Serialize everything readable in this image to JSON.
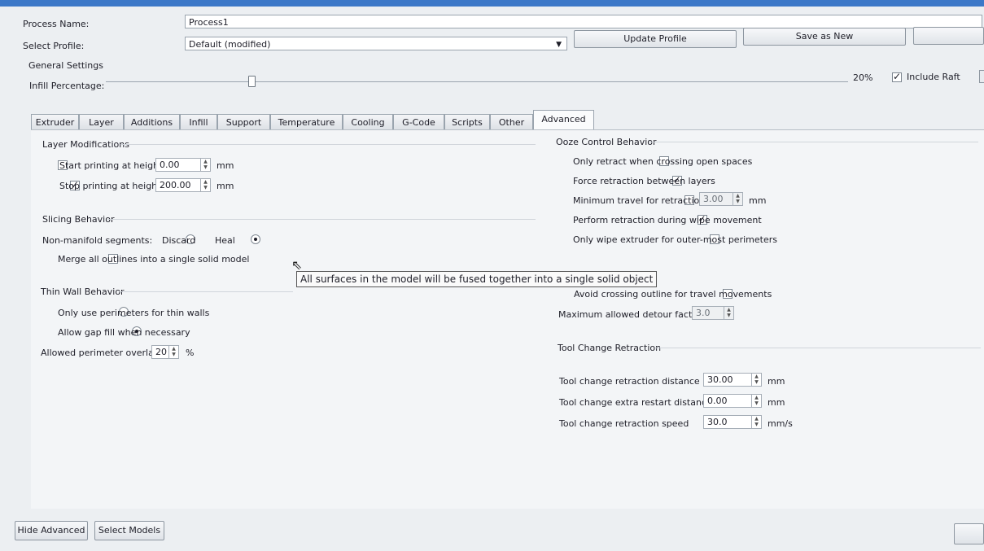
{
  "general": {
    "process_name_label": "Process Name:",
    "process_name_value": "Process1",
    "select_profile_label": "Select Profile:",
    "profile_value": "Default (modified)",
    "update_profile": "Update Profile",
    "save_as_new": "Save as New",
    "general_settings": "General Settings",
    "infill_label": "Infill Percentage:",
    "infill_percent_text": "20%",
    "infill_fraction": 0.2,
    "include_raft": "Include Raft"
  },
  "tabs": [
    "Extruder",
    "Layer",
    "Additions",
    "Infill",
    "Support",
    "Temperature",
    "Cooling",
    "G-Code",
    "Scripts",
    "Other",
    "Advanced"
  ],
  "active_tab": "Advanced",
  "layer_mod": {
    "title": "Layer Modifications",
    "start_label": "Start printing at height",
    "start_value": "0.00",
    "start_unit": "mm",
    "stop_label": "Stop printing at height",
    "stop_value": "200.00",
    "stop_unit": "mm"
  },
  "slicing": {
    "title": "Slicing Behavior",
    "nonmanifold_label": "Non-manifold segments:",
    "discard": "Discard",
    "heal": "Heal",
    "merge_label": "Merge all outlines into a single solid model"
  },
  "tooltip": "All surfaces in the model will be fused together into a single solid object",
  "thin_wall": {
    "title": "Thin Wall Behavior",
    "only_perimeters": "Only use perimeters for thin walls",
    "allow_gap": "Allow gap fill when necessary",
    "overlap_label": "Allowed perimeter overlap",
    "overlap_value": "20",
    "overlap_unit": "%"
  },
  "ooze": {
    "title": "Ooze Control Behavior",
    "only_retract": "Only retract when crossing open spaces",
    "force_retraction": "Force retraction between layers",
    "min_travel_label": "Minimum travel for retraction",
    "min_travel_value": "3.00",
    "min_travel_unit": "mm",
    "wipe_retraction": "Perform retraction during wipe movement",
    "only_wipe": "Only wipe extruder for outer-most perimeters",
    "avoid_crossing": "Avoid crossing outline for travel movements",
    "detour_label": "Maximum allowed detour factor",
    "detour_value": "3.0"
  },
  "tool_change": {
    "title": "Tool Change Retraction",
    "retraction_distance_label": "Tool change retraction distance",
    "retraction_distance_value": "30.00",
    "retraction_distance_unit": "mm",
    "extra_restart_label": "Tool change extra restart distance",
    "extra_restart_value": "0.00",
    "extra_restart_unit": "mm",
    "retraction_speed_label": "Tool change retraction speed",
    "retraction_speed_value": "30.0",
    "retraction_speed_unit": "mm/s"
  },
  "bottom": {
    "hide_advanced": "Hide Advanced",
    "select_models": "Select Models"
  },
  "colors": {
    "window_bg": "#eceff2",
    "panel_bg": "#f3f5f7",
    "title_bar": "#3c78c8"
  }
}
